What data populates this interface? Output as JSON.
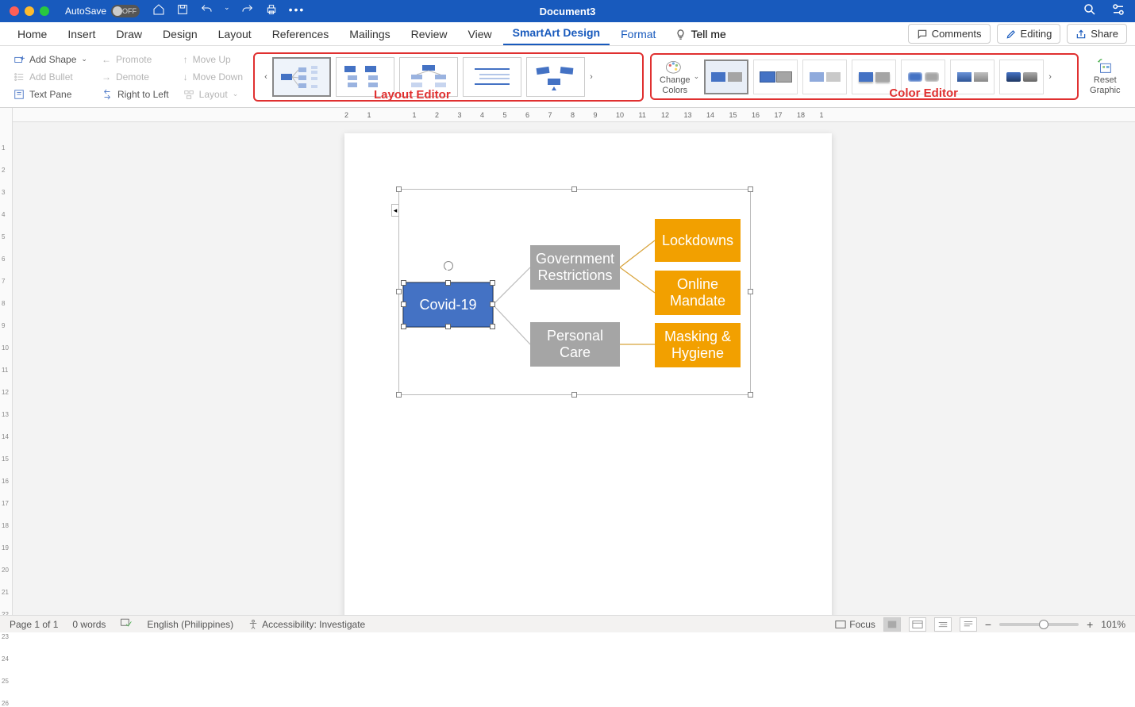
{
  "titlebar": {
    "autosave_label": "AutoSave",
    "autosave_state": "OFF",
    "document_title": "Document3"
  },
  "tabs": {
    "home": "Home",
    "insert": "Insert",
    "draw": "Draw",
    "design": "Design",
    "layout": "Layout",
    "references": "References",
    "mailings": "Mailings",
    "review": "Review",
    "view": "View",
    "smartart_design": "SmartArt Design",
    "format": "Format",
    "tell_me": "Tell me",
    "comments": "Comments",
    "editing": "Editing",
    "share": "Share"
  },
  "ribbon": {
    "add_shape": "Add Shape",
    "add_bullet": "Add Bullet",
    "text_pane": "Text Pane",
    "promote": "Promote",
    "demote": "Demote",
    "right_to_left": "Right to Left",
    "move_up": "Move Up",
    "move_down": "Move Down",
    "layout": "Layout",
    "change_colors": "Change",
    "change_colors2": "Colors",
    "reset": "Reset",
    "reset2": "Graphic"
  },
  "annotations": {
    "layout_editor": "Layout Editor",
    "color_editor": "Color Editor"
  },
  "smartart": {
    "root": "Covid-19",
    "mid1": "Government Restrictions",
    "mid2": "Personal Care",
    "leaf1": "Lockdowns",
    "leaf2": "Online Mandate",
    "leaf3": "Masking & Hygiene"
  },
  "statusbar": {
    "page": "Page 1 of 1",
    "words": "0 words",
    "language": "English (Philippines)",
    "accessibility": "Accessibility: Investigate",
    "focus": "Focus",
    "zoom": "101%"
  },
  "ruler_ticks": [
    "2",
    "1",
    "",
    "1",
    "2",
    "3",
    "4",
    "5",
    "6",
    "7",
    "8",
    "9",
    "10",
    "11",
    "12",
    "13",
    "14",
    "15",
    "16",
    "17",
    "18",
    "1"
  ]
}
